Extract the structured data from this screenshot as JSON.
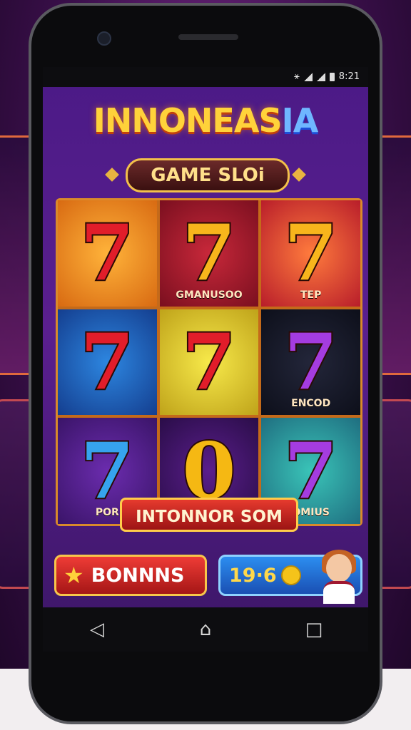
{
  "status_bar": {
    "time": "8:21"
  },
  "app": {
    "title_main": "INNONEAS",
    "title_tail": "IA",
    "subtitle": "GAME SLOi"
  },
  "reels": [
    {
      "symbol": "7",
      "caption": ""
    },
    {
      "symbol": "7",
      "caption": "GMANUSOO"
    },
    {
      "symbol": "7",
      "caption": "TEP"
    },
    {
      "symbol": "7",
      "caption": ""
    },
    {
      "symbol": "7",
      "caption": ""
    },
    {
      "symbol": "7",
      "caption": "ENCOD"
    },
    {
      "symbol": "7",
      "caption": "POR"
    },
    {
      "symbol": "0",
      "caption": ""
    },
    {
      "symbol": "7",
      "caption": "OMIUS"
    }
  ],
  "win_banner": "INTONNOR SOM",
  "buttons": {
    "bonus_label": "BONNNS",
    "score_value": "19·6"
  },
  "icons": {
    "back": "back-triangle-icon",
    "home": "home-icon",
    "recents": "recents-square-icon"
  },
  "colors": {
    "accent_gold": "#ffd23a",
    "accent_red": "#e11d2a",
    "accent_blue": "#2c8ef0"
  }
}
